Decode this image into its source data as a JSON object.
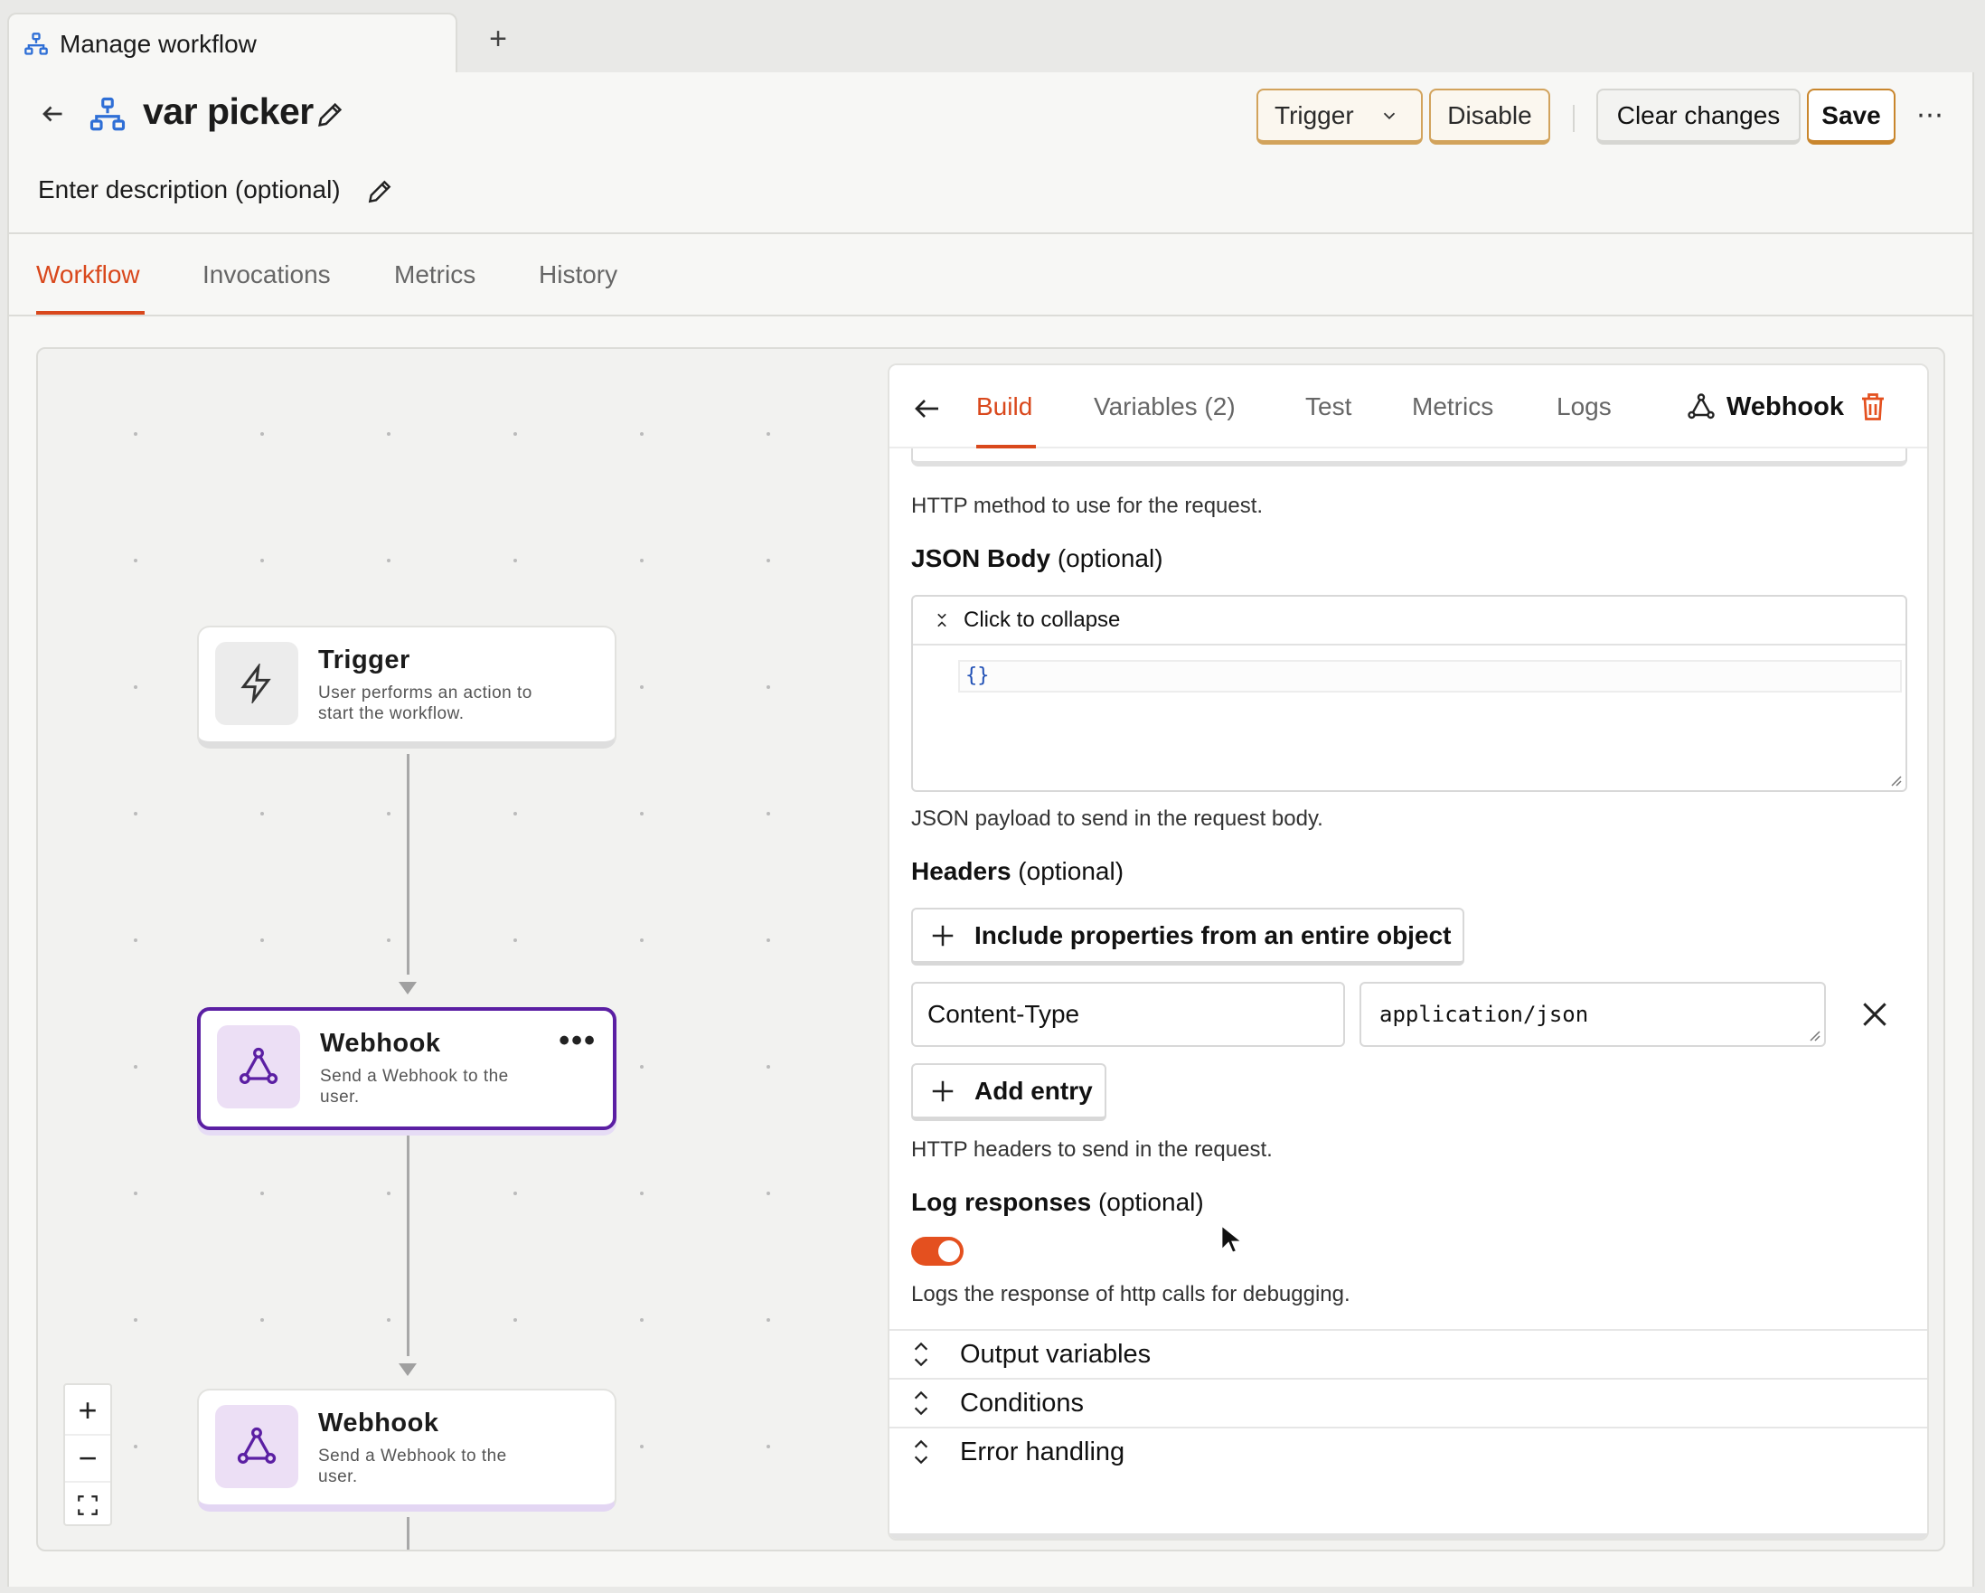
{
  "browser": {
    "tab_title": "Manage workflow",
    "new_tab": "+"
  },
  "header": {
    "title": "var picker",
    "description_placeholder": "Enter description (optional)",
    "trigger_label": "Trigger",
    "disable_label": "Disable",
    "clear_label": "Clear changes",
    "save_label": "Save",
    "more": "⋯"
  },
  "nav": {
    "tabs": [
      {
        "label": "Workflow",
        "active": true
      },
      {
        "label": "Invocations"
      },
      {
        "label": "Metrics"
      },
      {
        "label": "History"
      }
    ]
  },
  "canvas": {
    "nodes": [
      {
        "title": "Trigger",
        "desc": "User performs an action to start the workflow.",
        "icon": "lightning-icon"
      },
      {
        "title": "Webhook",
        "desc": "Send a Webhook to the user.",
        "icon": "webhook-icon",
        "selected": true
      },
      {
        "title": "Webhook",
        "desc": "Send a Webhook to the user.",
        "icon": "webhook-icon"
      }
    ],
    "node_menu": "•••",
    "zoom_in": "+",
    "zoom_out": "−"
  },
  "panel": {
    "tabs": {
      "build": "Build",
      "variables": "Variables  (2)",
      "test": "Test",
      "metrics": "Metrics",
      "logs": "Logs"
    },
    "step_name": "Webhook",
    "method_help": "HTTP method to use for the request.",
    "json_body_label": "JSON Body",
    "optional": "(optional)",
    "collapse_label": "Click to collapse",
    "json_value": "{}",
    "json_help": "JSON payload to send in the request body.",
    "headers_label": "Headers",
    "include_props_label": "Include properties from an entire object",
    "header_key": "Content-Type",
    "header_value": "application/json",
    "add_entry_label": "Add entry",
    "headers_help": "HTTP headers to send in the request.",
    "log_label": "Log responses",
    "log_enabled": true,
    "log_help": "Logs the response of http calls for debugging.",
    "sections": [
      "Output variables",
      "Conditions",
      "Error handling"
    ]
  },
  "colors": {
    "accent": "#d9481c",
    "selected_node": "#5b1fa3",
    "button_border": "#d2a35c"
  }
}
